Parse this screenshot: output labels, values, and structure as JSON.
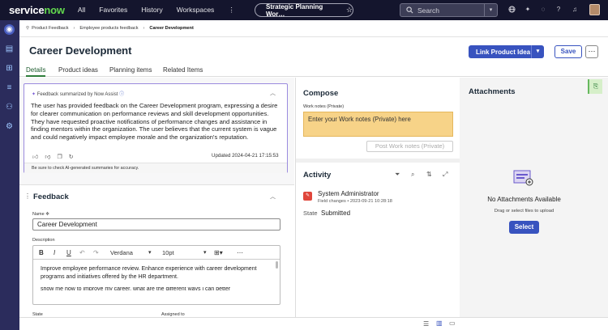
{
  "topbar": {
    "logo_a": "service",
    "logo_b": "now",
    "nav": [
      "All",
      "Favorites",
      "History",
      "Workspaces"
    ],
    "more": "⋮",
    "workspace_pill": "Strategic Planning Wor…",
    "star": "☆",
    "search_placeholder": "Search"
  },
  "breadcrumbs": [
    "Product Feedback",
    "Employee products feedback",
    "Career Development"
  ],
  "record": {
    "title": "Career Development",
    "link_button": "Link Product Idea",
    "save_button": "Save",
    "more_button": "⋯"
  },
  "tabs": [
    "Details",
    "Product ideas",
    "Planning items",
    "Related Items"
  ],
  "summary": {
    "header": "Feedback summarized by Now Assist",
    "text": "The user has provided feedback on the Career Development program, expressing a desire for clearer communication on performance reviews and skill development opportunities. They have requested proactive notifications of performance changes and assistance in finding mentors within the organization. The user believes that the current system is vague and could negatively impact employee morale and the organization's reputation.",
    "updated": "Updated 2024-04-21 17:15:53",
    "footer": "Be sure to check AI-generated summaries for accuracy."
  },
  "feedback": {
    "title": "Feedback",
    "name_label": "Name",
    "name_value": "Career Development",
    "description_label": "Description",
    "font": "Verdana",
    "size": "10pt",
    "body_1": "Improve employee performance review. Enhance experience with career development programs and initiatives offered by the HR department.",
    "body_2": "show me how to improve my career, what are the different ways i can better",
    "state_label": "State",
    "assigned_label": "Assigned to"
  },
  "compose": {
    "title": "Compose",
    "notes_label": "Work notes (Private)",
    "notes_placeholder": "Enter your Work notes (Private) here",
    "post_button": "Post Work notes (Private)"
  },
  "activity": {
    "title": "Activity",
    "author": "System Administrator",
    "meta": "Field changes • 2023-09-21 10:28:18",
    "state_label": "State",
    "state_value": "Submitted"
  },
  "attachments": {
    "title": "Attachments",
    "empty": "No Attachments Available",
    "hint": "Drag or select files to upload",
    "select_button": "Select"
  }
}
